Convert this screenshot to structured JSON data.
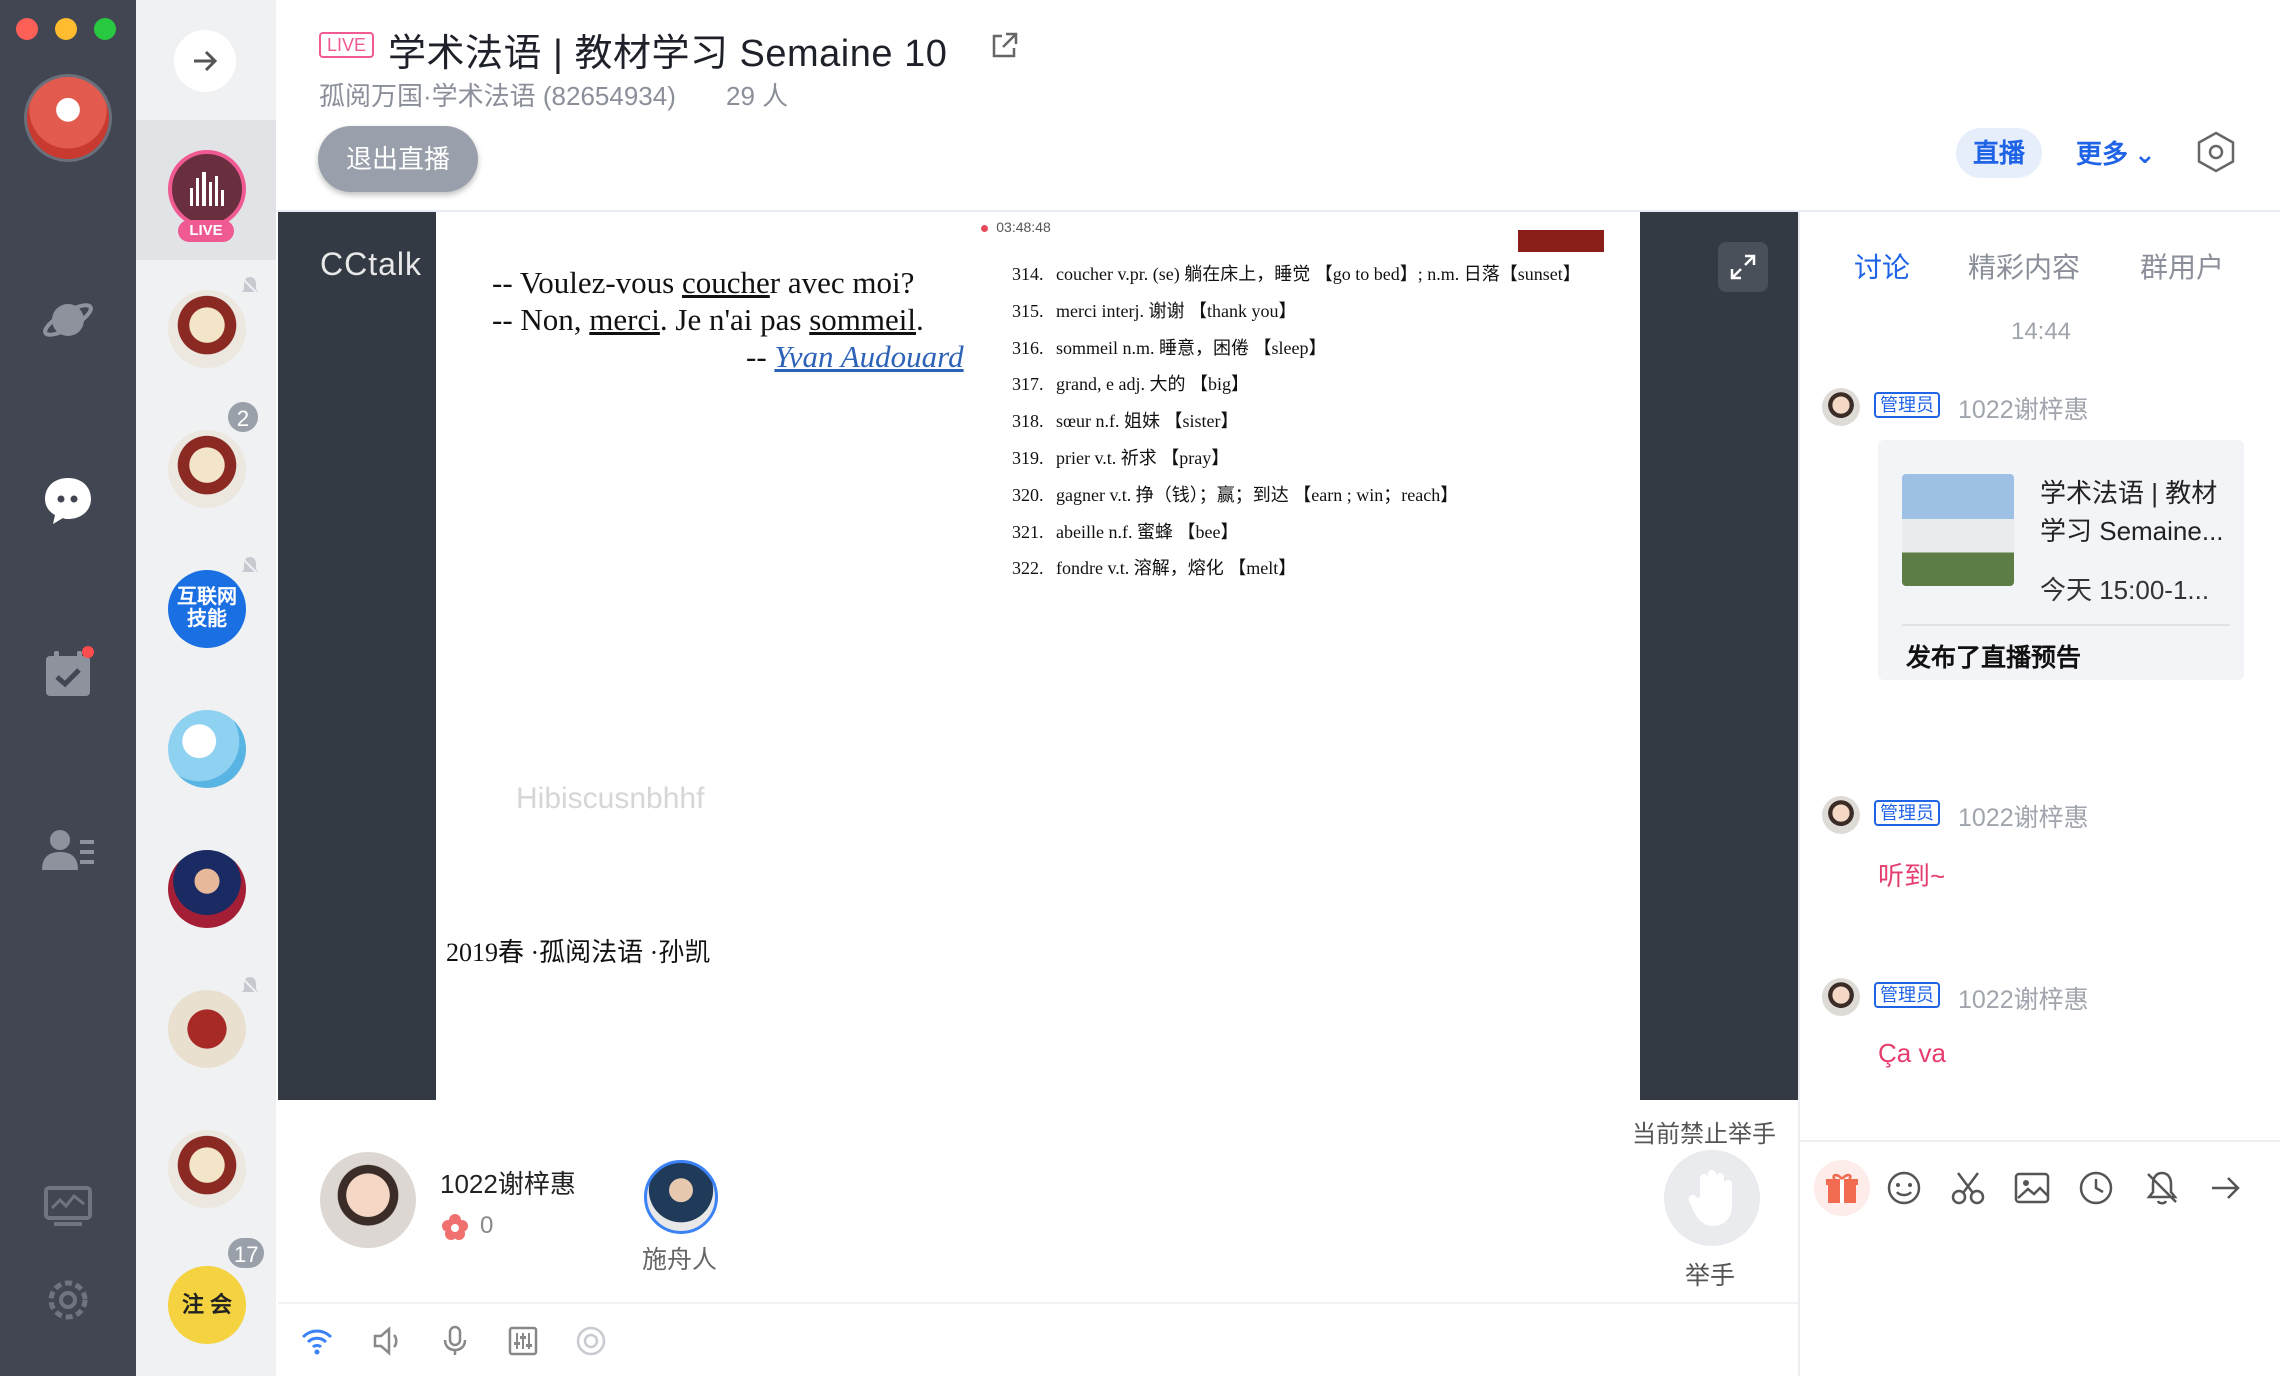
{
  "window": {
    "traffic_lights": [
      "close",
      "minimize",
      "zoom"
    ]
  },
  "rail": {
    "icons": [
      "planet-icon",
      "chat-bubble-icon",
      "task-check-icon",
      "contacts-icon",
      "monitor-chart-icon",
      "gear-icon"
    ]
  },
  "sessions": {
    "live_label": "LIVE",
    "items": [
      {
        "name": "live-session",
        "badge": ""
      },
      {
        "name": "crest-group-1",
        "badge": ""
      },
      {
        "name": "crest-group-2",
        "badge": "2"
      },
      {
        "name": "hulian-group",
        "badge": "",
        "text": "互联网\n技能"
      },
      {
        "name": "search-group",
        "badge": ""
      },
      {
        "name": "soccer-group",
        "badge": ""
      },
      {
        "name": "shield-group",
        "badge": ""
      },
      {
        "name": "crest-group-3",
        "badge": ""
      },
      {
        "name": "yellow-group",
        "badge": "17",
        "text": "注 会"
      }
    ]
  },
  "header": {
    "live_pill": "LIVE",
    "title": "学术法语 | 教材学习 Semaine 10",
    "subtitle": "孤阅万国·学术法语 (82654934)",
    "members": "29 人",
    "exit_button": "退出直播",
    "live_tab": "直播",
    "more": "更多",
    "more_chevron": "⌄"
  },
  "video": {
    "brand": "CCtalk",
    "timer": "03:48:48",
    "watermark": "Hibiscusnbhhf",
    "quote": {
      "line1_pre": "-- Voulez-vous ",
      "line1_u": "couche",
      "line1_post": "r avec moi?",
      "line2_pre": "-- Non, ",
      "line2_u1": "merci",
      "line2_mid": ". Je n'ai pas ",
      "line2_u2": "sommeil",
      "line2_post": ".",
      "author_prefix": "-- ",
      "author": "Yvan Audouard"
    },
    "vocab": [
      {
        "n": "314.",
        "text": "coucher v.pr. (se)  躺在床上，睡觉 【go to bed】; n.m. 日落【sunset】"
      },
      {
        "n": "315.",
        "text": "merci interj. 谢谢 【thank you】"
      },
      {
        "n": "316.",
        "text": "sommeil n.m. 睡意，困倦 【sleep】"
      },
      {
        "n": "317.",
        "text": "grand, e adj. 大的 【big】"
      },
      {
        "n": "318.",
        "text": "sœur n.f. 姐妹 【sister】"
      },
      {
        "n": "319.",
        "text": "prier v.t. 祈求 【pray】"
      },
      {
        "n": "320.",
        "text": "gagner v.t. 挣（钱）；赢；到达 【earn ; win；reach】"
      },
      {
        "n": "321.",
        "text": "abeille n.f. 蜜蜂 【bee】"
      },
      {
        "n": "322.",
        "text": "fondre v.t. 溶解，熔化 【melt】"
      }
    ],
    "footer_note": "2019春 ·孤阅法语 ·孙凯"
  },
  "stage": {
    "speaker_name": "1022谢梓惠",
    "flower_count": "0",
    "participant2_name": "施舟人",
    "hand_status": "当前禁止举手",
    "hand_label": "举手"
  },
  "toolbar": {
    "icons": [
      "wifi-icon",
      "speaker-icon",
      "microphone-icon",
      "equalizer-icon",
      "record-icon"
    ]
  },
  "right_panel": {
    "tabs": [
      "讨论",
      "精彩内容",
      "群用户"
    ],
    "active_tab": 0,
    "time": "14:44",
    "admin_tag": "管理员",
    "messages": [
      {
        "user": "1022谢梓惠",
        "card": {
          "title": "学术法语 | 教材学习 Semaine...",
          "time": "今天  15:00-1...",
          "footer": "发布了直播预告"
        }
      },
      {
        "user": "1022谢梓惠",
        "text": "听到~"
      },
      {
        "user": "1022谢梓惠",
        "text": "Ça va"
      }
    ],
    "tools": [
      "gift-icon",
      "emoji-icon",
      "scissors-icon",
      "image-icon",
      "clock-icon",
      "bell-icon",
      "send-arrow-icon"
    ]
  },
  "colors": {
    "rail_bg": "#424652",
    "accent_blue": "#1f63e6",
    "live_pink": "#f05a92",
    "message_pink": "#e53d6d"
  }
}
